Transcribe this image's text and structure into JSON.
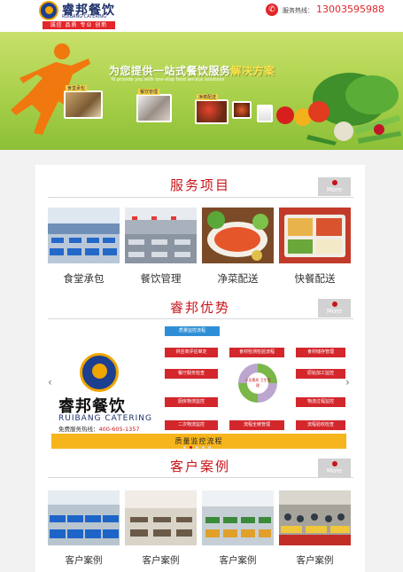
{
  "header": {
    "logo_cn": "睿邦餐饮",
    "logo_en": "RUIBANG CATERING",
    "logo_slogan": "诚信 品质 专业 创新",
    "hotline_label": "服务热线：",
    "hotline_number": "13003595988",
    "phone_icon": "phone-icon"
  },
  "banner": {
    "title_prefix": "为您提供一站式餐饮服务",
    "title_highlight": "解决方案",
    "subtitle": "To provide you with one-stop food service solutions",
    "photos": [
      {
        "label": "食堂承包"
      },
      {
        "label": "餐饮管理"
      },
      {
        "label": "净菜配送"
      },
      {
        "label": ""
      },
      {
        "label": ""
      }
    ],
    "colors": {
      "bg_top": "#c8e06a",
      "bg_bottom": "#8cbf37",
      "runner": "#f0780f"
    }
  },
  "services": {
    "title": "服务项目",
    "more_label": "More",
    "items": [
      {
        "label": "食堂承包"
      },
      {
        "label": "餐饮管理"
      },
      {
        "label": "净菜配送"
      },
      {
        "label": "快餐配送"
      }
    ]
  },
  "advantages": {
    "title": "睿邦优势",
    "more_label": "More",
    "slide": {
      "brand_cn": "睿邦餐饮",
      "brand_en": "RUIBANG CATERING",
      "hotline_prefix": "免费服务热线：",
      "hotline_number": "400-605-1357",
      "top_box": "质量监控流程",
      "left_boxes": [
        "供应商评估审定",
        "餐厅服务检查",
        "厨房物流监控",
        "二次物流监控"
      ],
      "mid_boxes": [
        "食材检测检验流程",
        "流程全链管理"
      ],
      "right_boxes": [
        "食材储存管理",
        "原始加工监控",
        "物流过程监控",
        "流程验收检查"
      ],
      "center_text": "人员素质 卫生管理",
      "bottom_bar": "质量监控流程",
      "dots_total": 5,
      "dots_active": 1
    }
  },
  "cases": {
    "title": "客户案例",
    "more_label": "More",
    "items": [
      {
        "label": "客户案例"
      },
      {
        "label": "客户案例"
      },
      {
        "label": "客户案例"
      },
      {
        "label": "客户案例"
      }
    ]
  },
  "colors": {
    "accent": "#c7141a",
    "page_bg": "#f2f2f2",
    "more_bg": "#d2d2d2",
    "quality_bar": "#f6b51d"
  }
}
